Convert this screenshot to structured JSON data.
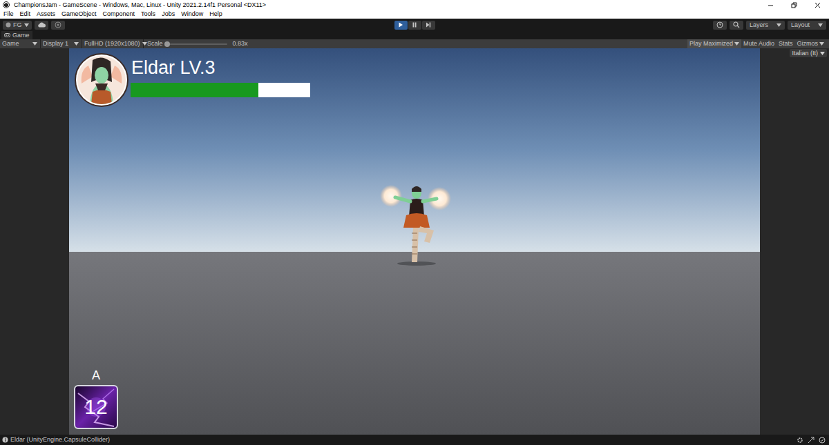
{
  "window": {
    "title": "ChampionsJam - GameScene - Windows, Mac, Linux - Unity 2021.2.14f1 Personal <DX11>"
  },
  "menu": [
    "File",
    "Edit",
    "Assets",
    "GameObject",
    "Component",
    "Tools",
    "Jobs",
    "Window",
    "Help"
  ],
  "toolbar": {
    "account": "FG",
    "playback": [
      {
        "kind": "play",
        "selected": true
      },
      {
        "kind": "pause",
        "selected": false
      },
      {
        "kind": "step",
        "selected": false
      }
    ],
    "layers": "Layers",
    "layout": "Layout"
  },
  "tabs": [
    {
      "label": "Game",
      "selected": true
    }
  ],
  "game_toolbar": {
    "view": "Game",
    "display": "Display 1",
    "resolution": "FullHD (1920x1080)",
    "scale": {
      "label": "Scale",
      "level": 0.02,
      "reading": "0.83x"
    },
    "toggles": [
      {
        "label": "Play Maximized",
        "selected": true
      },
      {
        "label": "Mute Audio",
        "selected": false
      },
      {
        "label": "Stats",
        "selected": false
      },
      {
        "label": "Gizmos",
        "selected": false
      }
    ]
  },
  "language": "Italian (It)",
  "hud": {
    "player": "Eldar LV.3",
    "health": {
      "level": 0.71
    },
    "skills": [
      {
        "key": "A",
        "cooldown": "12"
      }
    ]
  },
  "status_bar": {
    "message": "Eldar (UnityEngine.CapsuleCollider)"
  }
}
